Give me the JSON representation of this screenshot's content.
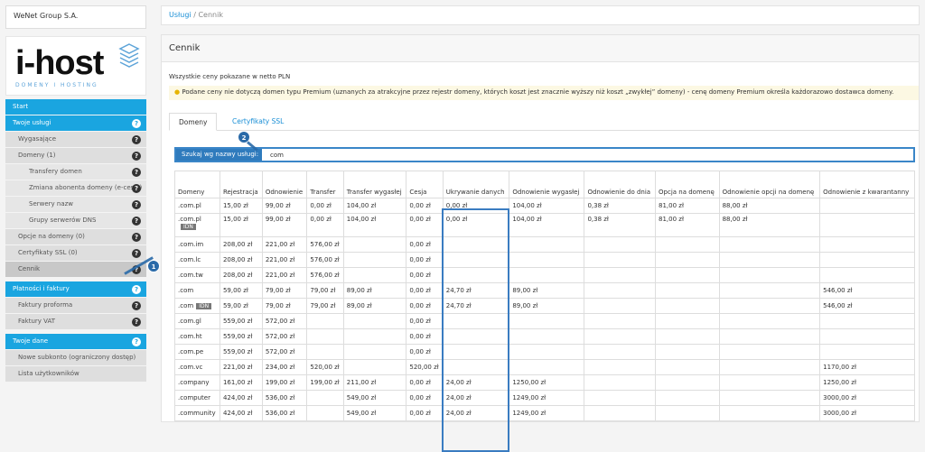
{
  "company": "WeNet Group S.A.",
  "logo": {
    "word": "i-host",
    "sub": "DOMENY I HOSTING"
  },
  "nav": [
    {
      "label": "Start",
      "type": "head",
      "q": false
    },
    {
      "label": "Twoje usługi",
      "type": "head",
      "q": true
    },
    {
      "label": "Wygasające",
      "type": "sub1",
      "q": true
    },
    {
      "label": "Domeny (1)",
      "type": "sub1",
      "q": true
    },
    {
      "label": "Transfery domen",
      "type": "sub2",
      "q": true
    },
    {
      "label": "Zmiana abonenta domeny (e-cesja)",
      "type": "sub2",
      "q": true
    },
    {
      "label": "Serwery nazw",
      "type": "sub2",
      "q": true
    },
    {
      "label": "Grupy serwerów DNS",
      "type": "sub2",
      "q": true
    },
    {
      "label": "Opcje na domeny (0)",
      "type": "sub1",
      "q": true
    },
    {
      "label": "Certyfikaty SSL (0)",
      "type": "sub1",
      "q": true
    },
    {
      "label": "Cennik",
      "type": "sub1 active",
      "q": true
    },
    {
      "label": "Płatności i faktury",
      "type": "head",
      "q": true
    },
    {
      "label": "Faktury proforma",
      "type": "sub1",
      "q": true
    },
    {
      "label": "Faktury VAT",
      "type": "sub1",
      "q": true
    },
    {
      "label": "Twoje dane",
      "type": "head",
      "q": true
    },
    {
      "label": "Nowe subkonto (ograniczony dostęp)",
      "type": "sub1",
      "q": false
    },
    {
      "label": "Lista użytkowników",
      "type": "sub1",
      "q": false
    }
  ],
  "breadcrumb": {
    "first": "Usługi",
    "sep": "/",
    "current": "Cennik"
  },
  "panel_title": "Cennik",
  "note": "Wszystkie ceny pokazane w netto PLN",
  "warning": "Podane ceny nie dotyczą domen typu Premium (uznanych za atrakcyjne przez rejestr domeny, których koszt jest znacznie wyższy niż koszt „zwykłej” domeny) - cenę domeny Premium określa każdorazowo dostawca domeny.",
  "tabs": [
    "Domeny",
    "Certyfikaty SSL"
  ],
  "search": {
    "label": "Szukaj wg nazwy usługi:",
    "value": "com"
  },
  "columns": [
    "Domeny",
    "Rejestracja",
    "Odnowienie",
    "Transfer",
    "Transfer wygasłej",
    "Cesja",
    "Ukrywanie danych",
    "Odnowienie wygasłej",
    "Odnowienie do dnia",
    "Opcja na domenę",
    "Odnowienie opcji na domenę",
    "Odnowienie z kwarantanny"
  ],
  "rows": [
    {
      "d": ".com.pl",
      "idn": false,
      "c": [
        "15,00 zł",
        "99,00 zł",
        "0,00 zł",
        "104,00 zł",
        "0,00 zł",
        "0,00 zł",
        "104,00 zł",
        "0,38 zł",
        "81,00 zł",
        "88,00 zł",
        ""
      ]
    },
    {
      "d": ".com.pl",
      "idn": true,
      "c": [
        "15,00 zł",
        "99,00 zł",
        "0,00 zł",
        "104,00 zł",
        "0,00 zł",
        "0,00 zł",
        "104,00 zł",
        "0,38 zł",
        "81,00 zł",
        "88,00 zł",
        ""
      ]
    },
    {
      "d": ".com.im",
      "idn": false,
      "c": [
        "208,00 zł",
        "221,00 zł",
        "576,00 zł",
        "",
        "0,00 zł",
        "",
        "",
        "",
        "",
        "",
        ""
      ]
    },
    {
      "d": ".com.lc",
      "idn": false,
      "c": [
        "208,00 zł",
        "221,00 zł",
        "576,00 zł",
        "",
        "0,00 zł",
        "",
        "",
        "",
        "",
        "",
        ""
      ]
    },
    {
      "d": ".com.tw",
      "idn": false,
      "c": [
        "208,00 zł",
        "221,00 zł",
        "576,00 zł",
        "",
        "0,00 zł",
        "",
        "",
        "",
        "",
        "",
        ""
      ]
    },
    {
      "d": ".com",
      "idn": false,
      "c": [
        "59,00 zł",
        "79,00 zł",
        "79,00 zł",
        "89,00 zł",
        "0,00 zł",
        "24,70 zł",
        "89,00 zł",
        "",
        "",
        "",
        "546,00 zł"
      ]
    },
    {
      "d": ".com",
      "idn": true,
      "c": [
        "59,00 zł",
        "79,00 zł",
        "79,00 zł",
        "89,00 zł",
        "0,00 zł",
        "24,70 zł",
        "89,00 zł",
        "",
        "",
        "",
        "546,00 zł"
      ]
    },
    {
      "d": ".com.gl",
      "idn": false,
      "c": [
        "559,00 zł",
        "572,00 zł",
        "",
        "",
        "0,00 zł",
        "",
        "",
        "",
        "",
        "",
        ""
      ]
    },
    {
      "d": ".com.ht",
      "idn": false,
      "c": [
        "559,00 zł",
        "572,00 zł",
        "",
        "",
        "0,00 zł",
        "",
        "",
        "",
        "",
        "",
        ""
      ]
    },
    {
      "d": ".com.pe",
      "idn": false,
      "c": [
        "559,00 zł",
        "572,00 zł",
        "",
        "",
        "0,00 zł",
        "",
        "",
        "",
        "",
        "",
        ""
      ]
    },
    {
      "d": ".com.vc",
      "idn": false,
      "c": [
        "221,00 zł",
        "234,00 zł",
        "520,00 zł",
        "",
        "520,00 zł",
        "",
        "",
        "",
        "",
        "",
        "1170,00 zł"
      ]
    },
    {
      "d": ".company",
      "idn": false,
      "c": [
        "161,00 zł",
        "199,00 zł",
        "199,00 zł",
        "211,00 zł",
        "0,00 zł",
        "24,00 zł",
        "1250,00 zł",
        "",
        "",
        "",
        "1250,00 zł"
      ]
    },
    {
      "d": ".computer",
      "idn": false,
      "c": [
        "424,00 zł",
        "536,00 zł",
        "",
        "549,00 zł",
        "0,00 zł",
        "24,00 zł",
        "1249,00 zł",
        "",
        "",
        "",
        "3000,00 zł"
      ]
    },
    {
      "d": ".community",
      "idn": false,
      "c": [
        "424,00 zł",
        "536,00 zł",
        "",
        "549,00 zł",
        "0,00 zł",
        "24,00 zł",
        "1249,00 zł",
        "",
        "",
        "",
        "3000,00 zł"
      ]
    }
  ],
  "idn_label": "IDN",
  "badges": [
    "1",
    "2"
  ]
}
